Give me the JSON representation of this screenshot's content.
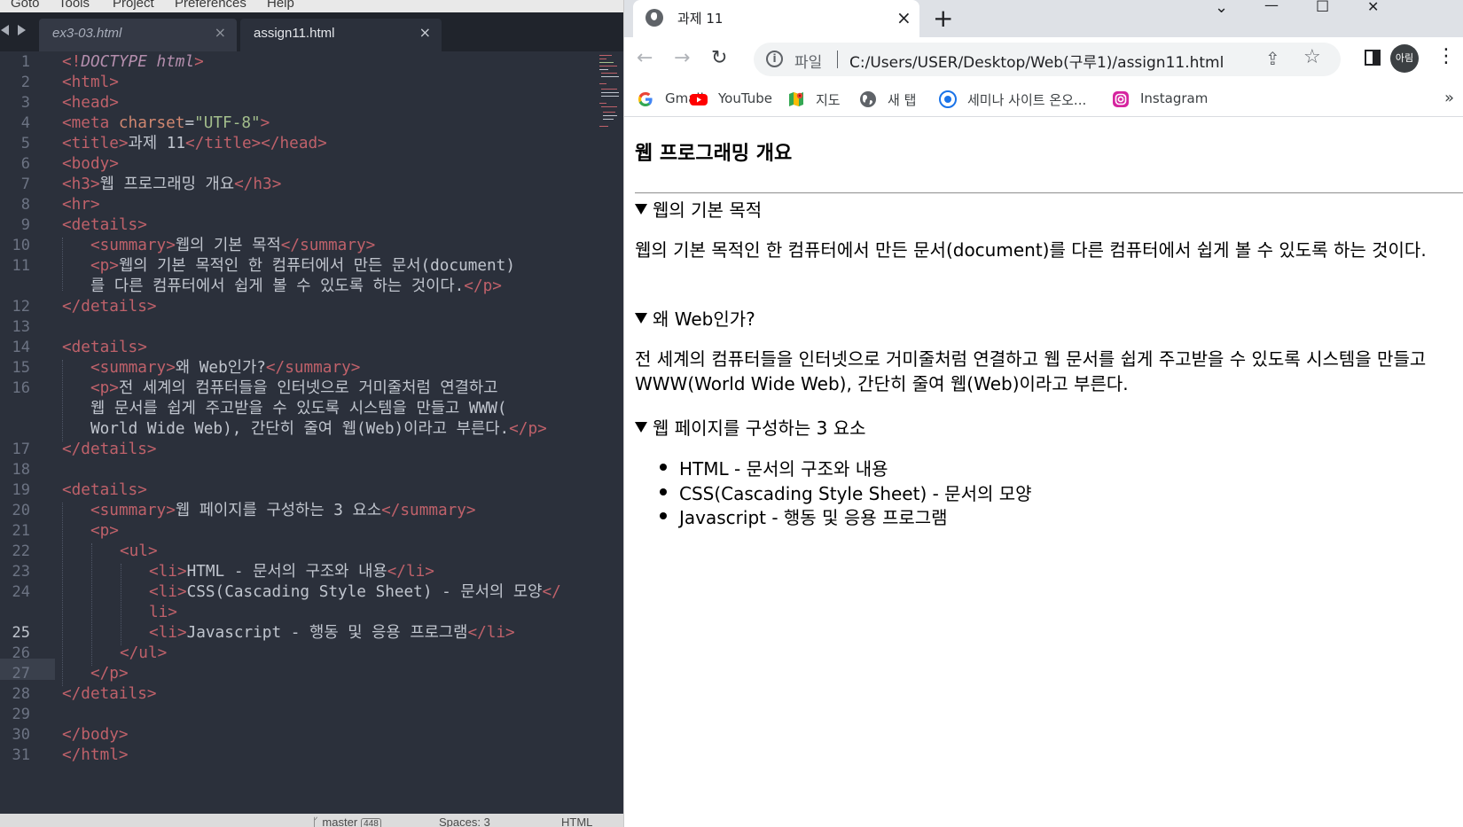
{
  "editor": {
    "menu": [
      "Goto",
      "Tools",
      "Project",
      "Preferences",
      "Help"
    ],
    "tabs": [
      {
        "label": "ex3-03.html",
        "active": false,
        "close": "×"
      },
      {
        "label": "assign11.html",
        "active": true,
        "close": "×"
      }
    ],
    "line_numbers": [
      "1",
      "2",
      "3",
      "4",
      "5",
      "6",
      "7",
      "8",
      "9",
      "10",
      "11",
      "12",
      "13",
      "14",
      "15",
      "16",
      "17",
      "18",
      "19",
      "20",
      "21",
      "22",
      "23",
      "24",
      "25",
      "26",
      "27",
      "28",
      "29",
      "30",
      "31"
    ],
    "current_line": "25",
    "code": {
      "l1_open": "<!",
      "l1_doctype": "DOCTYPE html",
      "l1_close": ">",
      "l2": "<html>",
      "l3": "<head>",
      "l4_tag": "<meta",
      "l4_attr": "charset",
      "l4_eq": "=",
      "l4_val": "\"UTF-8\"",
      "l4_end": ">",
      "l5_open": "<title>",
      "l5_text": "과제 11",
      "l5_close": "</title></head>",
      "l6": "<body>",
      "l7_open": "<h3>",
      "l7_text": "웹 프로그래밍 개요",
      "l7_close": "</h3>",
      "l8": "<hr>",
      "l9": "<details>",
      "l10_open": "<summary>",
      "l10_text": "웹의 기본 목적",
      "l10_close": "</summary>",
      "l11_open": "<p>",
      "l11_text": "웹의 기본 목적인 한 컴퓨터에서 만든 문서(document)",
      "l11b_text": "를 다른 컴퓨터에서 쉽게 볼 수 있도록 하는 것이다.",
      "l11b_close": "</p>",
      "l12": "</details>",
      "l14": "<details>",
      "l15_open": "<summary>",
      "l15_text": "왜 Web인가?",
      "l15_close": "</summary>",
      "l16_open": "<p>",
      "l16_text": "전 세계의 컴퓨터들을 인터넷으로 거미줄처럼 연결하고",
      "l16b_text": "웹 문서를 쉽게 주고받을 수 있도록 시스템을 만들고 WWW(",
      "l16c_text": "World Wide Web), 간단히 줄여 웹(Web)이라고 부른다.",
      "l16c_close": "</p>",
      "l17": "</details>",
      "l19": "<details>",
      "l20_open": "<summary>",
      "l20_text": "웹 페이지를 구성하는 3 요소",
      "l20_close": "</summary>",
      "l21": "<p>",
      "l22": "<ul>",
      "l23_open": "<li>",
      "l23_text": "HTML - 문서의 구조와 내용",
      "l23_close": "</li>",
      "l24_open": "<li>",
      "l24_text": "CSS(Cascading Style Sheet) - 문서의 모양",
      "l24_close": "</",
      "l24b": "li>",
      "l25_open": "<li>",
      "l25_text": "Javascript - 행동 및 응용 프로그램",
      "l25_close": "</li>",
      "l26": "</ul>",
      "l27": "</p>",
      "l28": "</details>",
      "l30": "</body>",
      "l31": "</html>"
    },
    "status": {
      "branch": "master",
      "branch_count": "448",
      "spaces": "Spaces: 3",
      "syntax": "HTML"
    },
    "colors": {
      "background": "#2b303b",
      "tag": "#bf616a",
      "attr": "#d08770",
      "string": "#a3be8c",
      "doctype": "#b48ead",
      "text": "#c0c5ce"
    }
  },
  "browser": {
    "tab": {
      "title": "과제 11",
      "close": "×"
    },
    "new_tab": "+",
    "window_controls": {
      "dropdown": "⌄",
      "minimize": "—",
      "maximize": "☐",
      "close": "✕"
    },
    "toolbar": {
      "back": "←",
      "forward": "→",
      "reload": "↻",
      "info": "i",
      "chip": "파일",
      "url": "C:/Users/USER/Desktop/Web(구루1)/assign11.html",
      "share": "⇪",
      "star": "☆",
      "avatar": "아림",
      "menu": "⋮"
    },
    "bookmarks": [
      {
        "label": "Gmail",
        "icon": "google-icon"
      },
      {
        "label": "YouTube",
        "icon": "youtube-icon"
      },
      {
        "label": "지도",
        "icon": "maps-icon"
      },
      {
        "label": "새 탭",
        "icon": "globe-icon"
      },
      {
        "label": "세미나 사이트 온오...",
        "icon": "seminar-icon"
      },
      {
        "label": "Instagram",
        "icon": "instagram-icon"
      }
    ],
    "bookmarks_more": "»",
    "page": {
      "heading": "웹 프로그래밍 개요",
      "details": [
        {
          "summary": "웹의 기본 목적",
          "text": "웹의 기본 목적인 한 컴퓨터에서 만든 문서(document)를 다른 컴퓨터에서 쉽게 볼 수 있도록 하는 것이다."
        },
        {
          "summary": "왜 Web인가?",
          "text": "전 세계의 컴퓨터들을 인터넷으로 거미줄처럼 연결하고 웹 문서를 쉽게 주고받을 수 있도록 시스템을 만들고 WWW(World Wide Web), 간단히 줄여 웹(Web)이라고 부른다."
        },
        {
          "summary": "웹 페이지를 구성하는 3 요소",
          "items": [
            "HTML - 문서의 구조와 내용",
            "CSS(Cascading Style Sheet) - 문서의 모양",
            "Javascript - 행동 및 응용 프로그램"
          ]
        }
      ]
    }
  }
}
